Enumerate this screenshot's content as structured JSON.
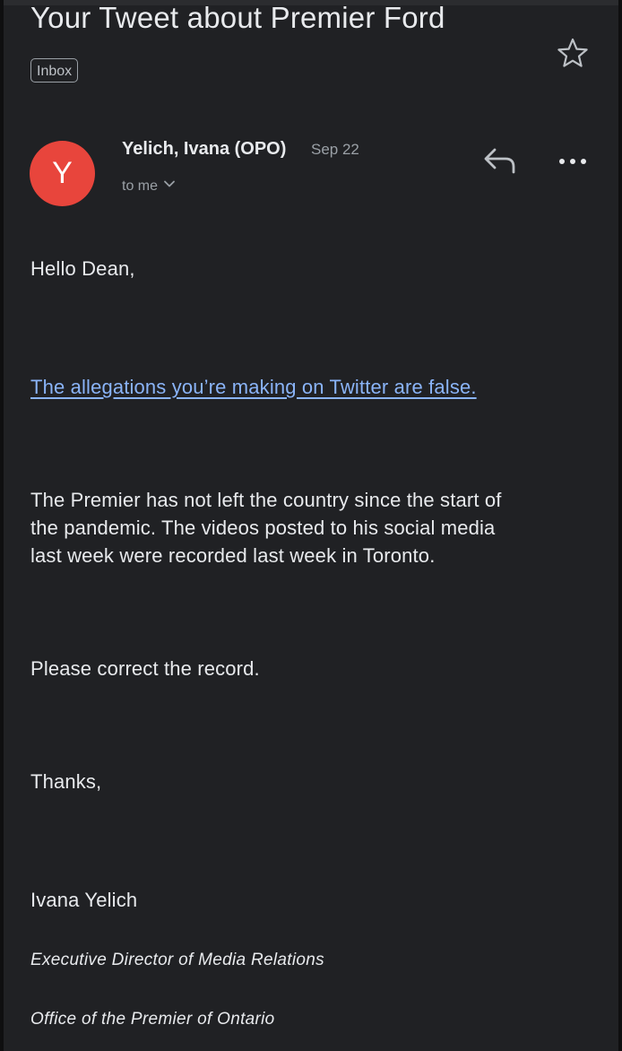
{
  "email": {
    "subject": "Your Tweet about Premier Ford",
    "label": "Inbox",
    "sender": {
      "initial": "Y",
      "name": "Yelich, Ivana (OPO)",
      "date": "Sep 22",
      "recipient": "to me",
      "avatar_color": "#e8453c"
    },
    "body": {
      "greeting": "Hello Dean,",
      "link_text": "The allegations you’re making on Twitter are false.",
      "paragraph_lines": [
        "The Premier has not left the country since the start of",
        "the pandemic. The videos posted to his social media",
        "last week were recorded last week in Toronto."
      ],
      "request": "Please correct the record.",
      "closing": "Thanks,",
      "signature": {
        "name": "Ivana Yelich",
        "title": "Executive Director of Media Relations",
        "office": "Office of the Premier of Ontario"
      }
    }
  },
  "icons": {
    "star": "star-outline-icon",
    "reply": "reply-arrow-icon",
    "more": "more-horizontal-icon",
    "expand": "chevron-down-icon"
  },
  "colors": {
    "background": "#202124",
    "text": "#e8eaed",
    "secondary_text": "#9aa0a6",
    "link": "#8ab4f8"
  }
}
